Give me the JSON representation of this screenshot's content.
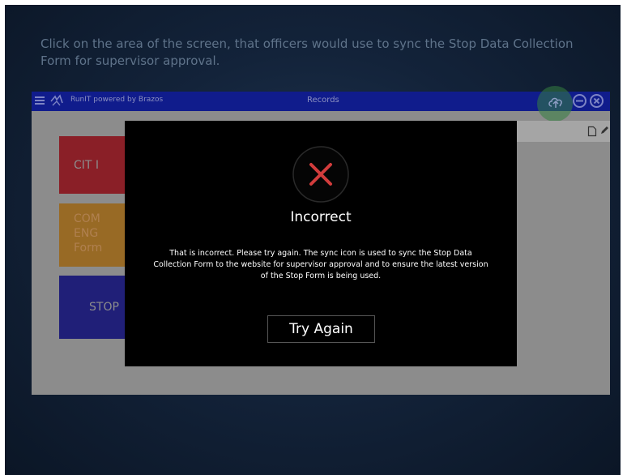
{
  "instruction": "Click on the area of the screen, that officers would use to sync the Stop Data Collection Form for supervisor approval.",
  "app": {
    "brand": "RunIT powered by Brazos",
    "title": "Records",
    "icons": [
      "menu-icon",
      "logo-icon",
      "cloud-sync-icon",
      "minus-icon",
      "close-icon",
      "document-icon",
      "pencil-icon"
    ],
    "tiles": [
      {
        "label": "CIT I",
        "color": "#8a1f27"
      },
      {
        "label": "COM\nENG\nForm",
        "color": "#986a25"
      },
      {
        "label": "STOP",
        "color": "#201f78"
      }
    ]
  },
  "modal": {
    "icon": "x-mark-icon",
    "title": "Incorrect",
    "message": "That is incorrect. Please try again. The sync icon is used to sync the Stop Data Collection Form to the website for supervisor approval and to ensure the latest version of the Stop Form is being used.",
    "button_label": "Try Again"
  },
  "colors": {
    "header": "#101c8c",
    "modal_bg": "#000000",
    "x_mark": "#d23c3c",
    "sync_highlight": "#348040"
  }
}
